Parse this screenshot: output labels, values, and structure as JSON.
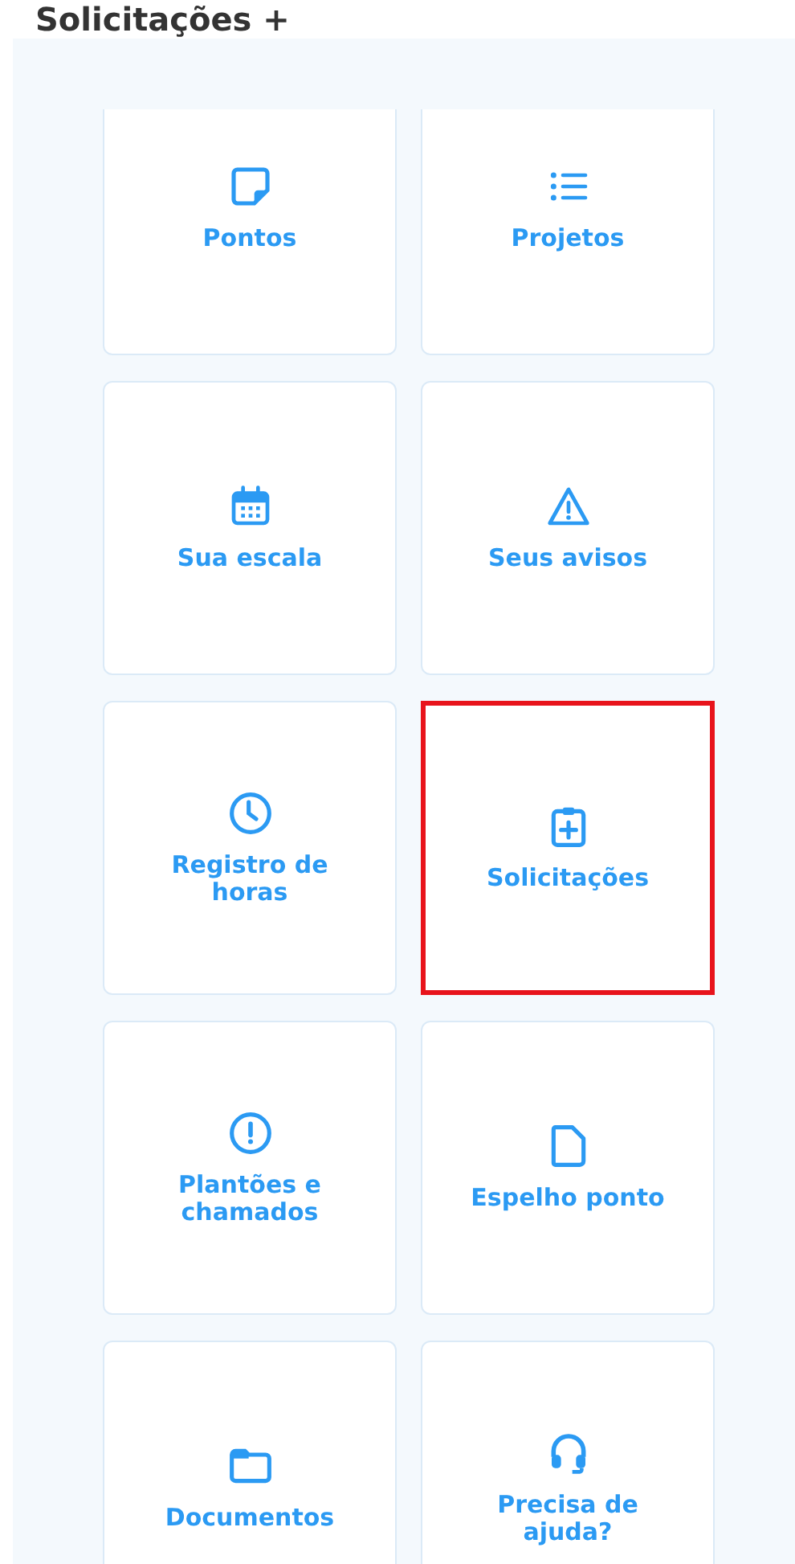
{
  "heading": "Solicitações +",
  "tiles": [
    {
      "label": "Pontos",
      "highlighted": false
    },
    {
      "label": "Projetos",
      "highlighted": false
    },
    {
      "label": "Sua escala",
      "highlighted": false
    },
    {
      "label": "Seus avisos",
      "highlighted": false
    },
    {
      "label": "Registro de horas",
      "highlighted": false
    },
    {
      "label": "Solicitações",
      "highlighted": true
    },
    {
      "label": "Plantões e chamados",
      "highlighted": false
    },
    {
      "label": "Espelho ponto",
      "highlighted": false
    },
    {
      "label": "Documentos",
      "highlighted": false
    },
    {
      "label": "Precisa de ajuda?",
      "highlighted": false
    }
  ]
}
